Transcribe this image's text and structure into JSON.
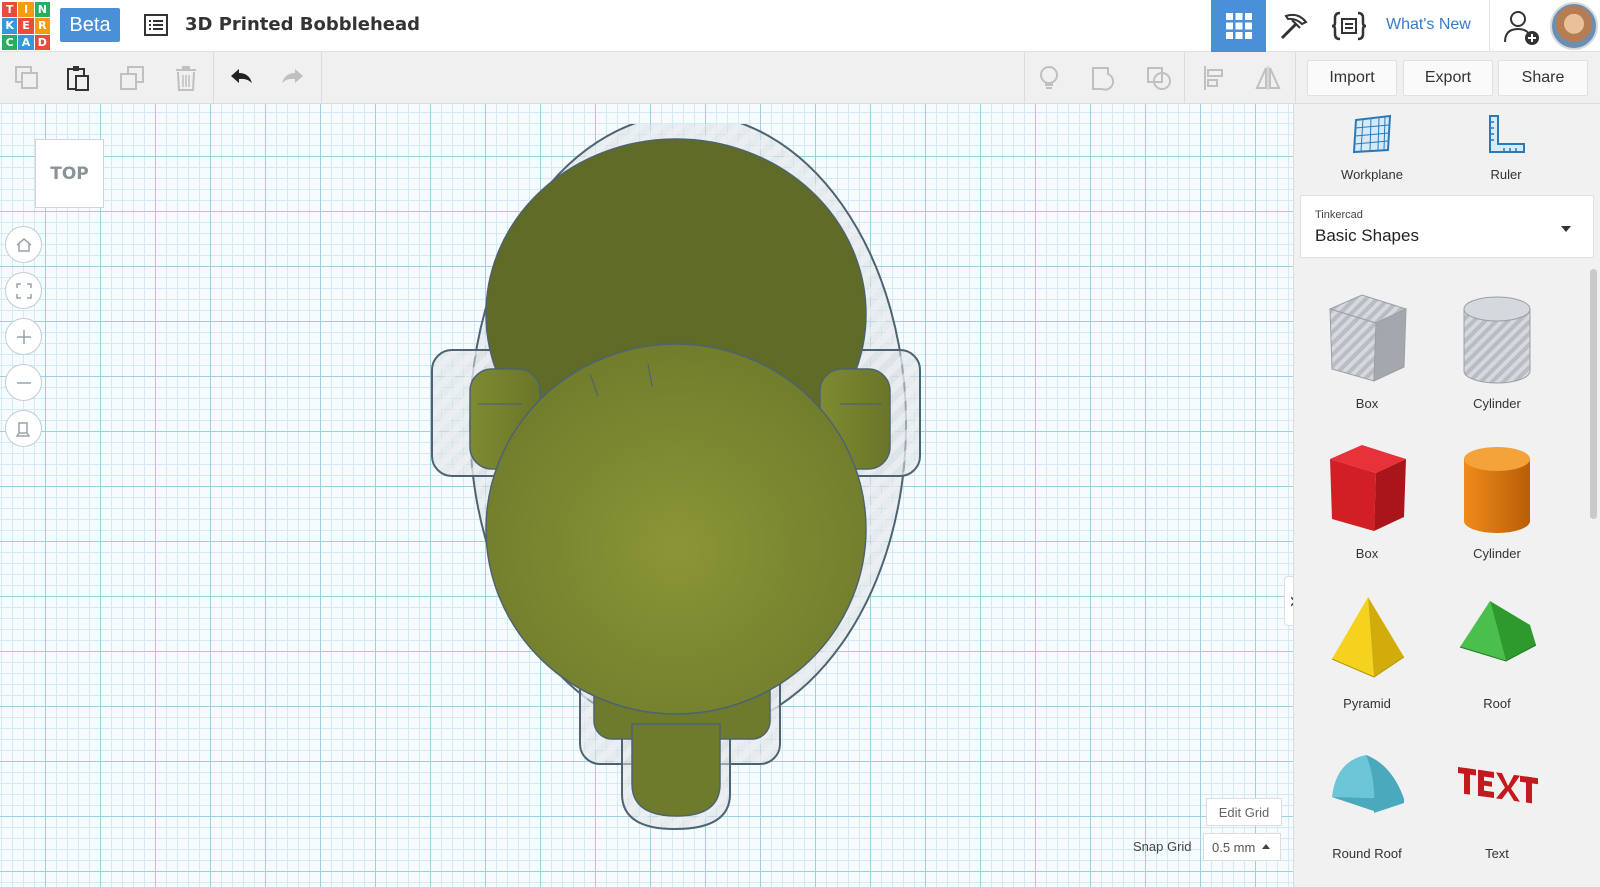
{
  "header": {
    "logo_letters": [
      "T",
      "I",
      "N",
      "K",
      "E",
      "R",
      "C",
      "A",
      "D"
    ],
    "logo_colors": [
      "#e74c3c",
      "#f39c12",
      "#27ae60",
      "#3498db",
      "#e74c3c",
      "#f39c12",
      "#27ae60",
      "#3498db",
      "#e74c3c"
    ],
    "beta_label": "Beta",
    "project_title": "3D Printed Bobblehead",
    "whats_new": "What's New"
  },
  "toolbar": {
    "import": "Import",
    "export": "Export",
    "share": "Share"
  },
  "canvas": {
    "viewcube_label": "TOP",
    "edit_grid": "Edit Grid",
    "snap_grid_label": "Snap Grid",
    "snap_grid_value": "0.5 mm"
  },
  "panel": {
    "workplane": "Workplane",
    "ruler": "Ruler",
    "library_small": "Tinkercad",
    "library_name": "Basic Shapes",
    "shapes": [
      "Box",
      "Cylinder",
      "Box",
      "Cylinder",
      "Pyramid",
      "Roof",
      "Round Roof",
      "Text"
    ]
  },
  "colors": {
    "accent": "#4a90d9",
    "model_olive": "#6e7a2c",
    "model_olive_light": "#8a9636",
    "box_red": "#d21f26",
    "cylinder_orange": "#e07a10",
    "pyramid_yellow": "#f2cc1a",
    "roof_green": "#3aa63a",
    "roundroof_teal": "#5bb9cc"
  }
}
